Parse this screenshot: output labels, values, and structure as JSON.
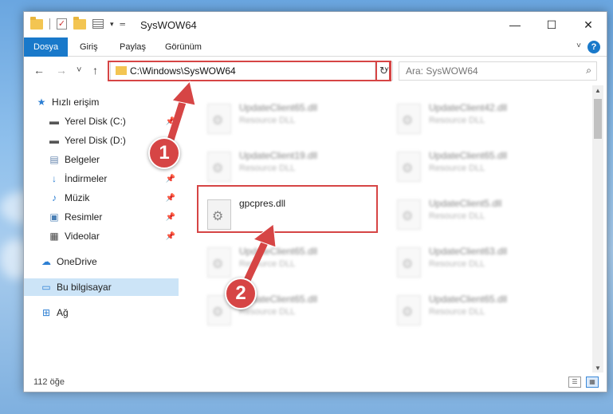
{
  "window": {
    "title": "SysWOW64",
    "controls": {
      "minimize": "—",
      "maximize": "☐",
      "close": "✕"
    }
  },
  "ribbon": {
    "tabs": [
      "Dosya",
      "Giriş",
      "Paylaş",
      "Görünüm"
    ],
    "help": "?"
  },
  "navigation": {
    "back": "←",
    "forward": "→",
    "recent": "˅",
    "up": "↑",
    "address": "C:\\Windows\\SysWOW64",
    "refresh": "↻",
    "search_placeholder": "Ara: SysWOW64"
  },
  "sidebar": {
    "items": [
      {
        "label": "Hızlı erişim",
        "icon": "star-icon",
        "pinned": false
      },
      {
        "label": "Yerel Disk (C:)",
        "icon": "drive-icon",
        "pinned": true
      },
      {
        "label": "Yerel Disk (D:)",
        "icon": "drive-icon",
        "pinned": true
      },
      {
        "label": "Belgeler",
        "icon": "documents-icon",
        "pinned": true
      },
      {
        "label": "İndirmeler",
        "icon": "download-icon",
        "pinned": true
      },
      {
        "label": "Müzik",
        "icon": "music-icon",
        "pinned": true
      },
      {
        "label": "Resimler",
        "icon": "pictures-icon",
        "pinned": true
      },
      {
        "label": "Videolar",
        "icon": "video-icon",
        "pinned": true
      },
      {
        "label": "OneDrive",
        "icon": "cloud-icon",
        "pinned": false
      },
      {
        "label": "Bu bilgisayar",
        "icon": "computer-icon",
        "pinned": false
      },
      {
        "label": "Ağ",
        "icon": "network-icon",
        "pinned": false
      }
    ],
    "selected": "Bu bilgisayar"
  },
  "files": [
    {
      "name": "UpdateClient65.dll",
      "type": "Resource DLL",
      "blurred": true
    },
    {
      "name": "UpdateClient42.dll",
      "type": "Resource DLL",
      "blurred": true
    },
    {
      "name": "UpdateClient19.dll",
      "type": "Resource DLL",
      "blurred": true
    },
    {
      "name": "UpdateClient65.dll",
      "type": "Resource DLL",
      "blurred": true
    },
    {
      "name": "gpcpres.dll",
      "type": "",
      "blurred": false
    },
    {
      "name": "UpdateClient5.dll",
      "type": "Resource DLL",
      "blurred": true
    },
    {
      "name": "UpdateClient65.dll",
      "type": "Resource DLL",
      "blurred": true
    },
    {
      "name": "UpdateClient63.dll",
      "type": "Resource DLL",
      "blurred": true
    },
    {
      "name": "UpdateClient65.dll",
      "type": "Resource DLL",
      "blurred": true
    },
    {
      "name": "UpdateClient65.dll",
      "type": "Resource DLL",
      "blurred": true
    }
  ],
  "status": {
    "count": "112 öğe"
  },
  "annotations": {
    "step1": "1",
    "step2": "2",
    "color": "#d64545"
  }
}
